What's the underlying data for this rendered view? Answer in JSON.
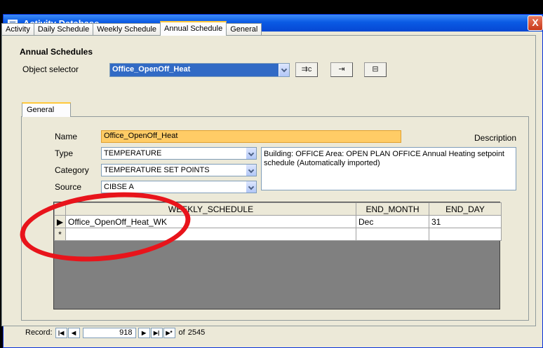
{
  "window": {
    "title": "Activity Database",
    "close_glyph": "X"
  },
  "tabs": [
    {
      "label": "Activity"
    },
    {
      "label": "Daily Schedule"
    },
    {
      "label": "Weekly Schedule"
    },
    {
      "label": "Annual Schedule",
      "active": true
    },
    {
      "label": "General"
    }
  ],
  "section": {
    "title": "Annual Schedules",
    "object_selector_label": "Object selector",
    "object_selector_value": "Office_OpenOff_Heat",
    "toolbar_icons": [
      "new-record-icon",
      "copy-record-icon",
      "delete-record-icon"
    ]
  },
  "inner_tab": {
    "label": "General"
  },
  "form": {
    "name_label": "Name",
    "name_value": "Office_OpenOff_Heat",
    "type_label": "Type",
    "type_value": "TEMPERATURE",
    "category_label": "Category",
    "category_value": "TEMPERATURE SET POINTS",
    "source_label": "Source",
    "source_value": "CIBSE A",
    "description_label": "Description",
    "description_value": "Building: OFFICE Area: OPEN PLAN OFFICE Annual Heating setpoint schedule (Automatically imported)"
  },
  "grid": {
    "columns": [
      "WEEKLY_SCHEDULE",
      "END_MONTH",
      "END_DAY"
    ],
    "rows": [
      {
        "selector": "▶",
        "weekly_schedule": "Office_OpenOff_Heat_WK",
        "end_month": "Dec",
        "end_day": "31"
      },
      {
        "selector": "*",
        "weekly_schedule": "",
        "end_month": "",
        "end_day": ""
      }
    ]
  },
  "record_nav": {
    "label": "Record:",
    "current": "918",
    "of_label": "of",
    "total": "2545"
  },
  "annotation": {
    "color": "#e8141b",
    "shape": "red-ellipse-around-row"
  },
  "colors": {
    "title_bar": "#0a5ae4",
    "highlight": "#ffcc66",
    "selection": "#316ac5"
  }
}
